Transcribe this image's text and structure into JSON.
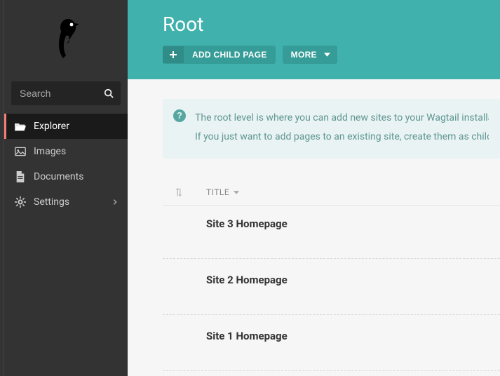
{
  "sidebar": {
    "search_placeholder": "Search",
    "items": [
      {
        "label": "Explorer"
      },
      {
        "label": "Images"
      },
      {
        "label": "Documents"
      },
      {
        "label": "Settings"
      }
    ]
  },
  "header": {
    "title": "Root",
    "add_child_label": "ADD CHILD PAGE",
    "more_label": "MORE"
  },
  "info": {
    "line1": "The root level is where you can add new sites to your Wagtail installation.",
    "line2": "If you just want to add pages to an existing site, create them as children of that site."
  },
  "table": {
    "title_col": "TITLE",
    "rows": [
      {
        "title": "Site 3 Homepage"
      },
      {
        "title": "Site 2 Homepage"
      },
      {
        "title": "Site 1 Homepage"
      }
    ]
  }
}
